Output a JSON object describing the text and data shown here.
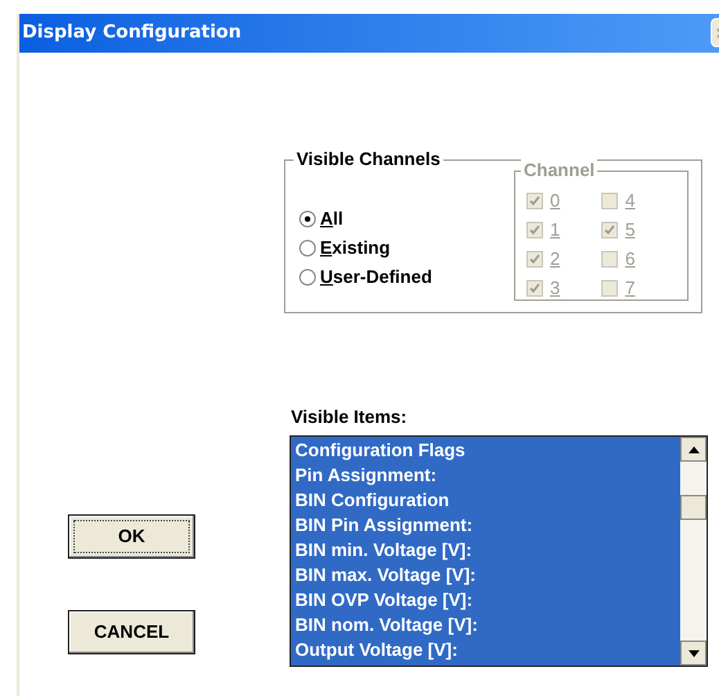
{
  "window": {
    "title": "Display Configuration"
  },
  "visible_channels": {
    "title": "Visible Channels",
    "options": [
      {
        "label": "All",
        "selected": true
      },
      {
        "label": "Existing",
        "selected": false
      },
      {
        "label": "User-Defined",
        "selected": false
      }
    ],
    "channel_group": {
      "title": "Channel",
      "channels": [
        {
          "label": "0",
          "checked": true,
          "disabled": true
        },
        {
          "label": "4",
          "checked": false,
          "disabled": true
        },
        {
          "label": "1",
          "checked": true,
          "disabled": true
        },
        {
          "label": "5",
          "checked": true,
          "disabled": true
        },
        {
          "label": "2",
          "checked": true,
          "disabled": true
        },
        {
          "label": "6",
          "checked": false,
          "disabled": true
        },
        {
          "label": "3",
          "checked": true,
          "disabled": true
        },
        {
          "label": "7",
          "checked": false,
          "disabled": true
        }
      ]
    }
  },
  "visible_items": {
    "label": "Visible Items:",
    "items": [
      {
        "label": "Configuration Flags",
        "selected": true
      },
      {
        "label": "Pin Assignment:",
        "selected": true
      },
      {
        "label": "BIN Configuration",
        "selected": true
      },
      {
        "label": "BIN Pin Assignment:",
        "selected": true
      },
      {
        "label": "BIN min. Voltage [V]:",
        "selected": true
      },
      {
        "label": "BIN max. Voltage [V]:",
        "selected": true
      },
      {
        "label": "BIN OVP Voltage [V]:",
        "selected": true
      },
      {
        "label": "BIN nom. Voltage [V]:",
        "selected": true
      },
      {
        "label": "Output Voltage [V]:",
        "selected": true
      }
    ]
  },
  "buttons": [
    {
      "label": "OK",
      "focused": true
    },
    {
      "label": "CANCEL",
      "focused": false
    }
  ]
}
